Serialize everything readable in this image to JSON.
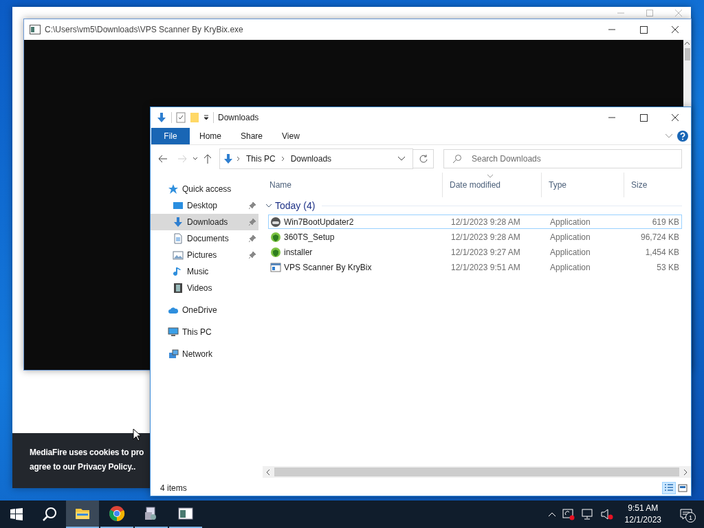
{
  "browser_window": {
    "cookie_banner": {
      "lines": [
        "MediaFire uses cookies to pro",
        "agree to our Privacy Policy.."
      ]
    }
  },
  "console_window": {
    "title": "C:\\Users\\vm5\\Downloads\\VPS Scanner By KryBix.exe"
  },
  "explorer": {
    "title": "Downloads",
    "ribbon_tabs": [
      {
        "label": "File",
        "kind": "menu"
      },
      {
        "label": "Home",
        "kind": "tab"
      },
      {
        "label": "Share",
        "kind": "tab"
      },
      {
        "label": "View",
        "kind": "tab"
      }
    ],
    "address": [
      "This PC",
      "Downloads"
    ],
    "search": {
      "placeholder": "Search Downloads"
    },
    "nav": [
      {
        "label": "Quick access",
        "selected": false,
        "children": [
          {
            "label": "Desktop",
            "selected": false,
            "pinned": true
          },
          {
            "label": "Downloads",
            "selected": true,
            "pinned": true
          },
          {
            "label": "Documents",
            "selected": false,
            "pinned": true
          },
          {
            "label": "Pictures",
            "selected": false,
            "pinned": true
          },
          {
            "label": "Music",
            "selected": false,
            "pinned": false
          },
          {
            "label": "Videos",
            "selected": false,
            "pinned": false
          }
        ]
      },
      {
        "label": "OneDrive",
        "selected": false
      },
      {
        "label": "This PC",
        "selected": false
      },
      {
        "label": "Network",
        "selected": false
      }
    ],
    "columns": [
      {
        "label": "Name",
        "sorted": false
      },
      {
        "label": "Date modified",
        "sorted": true
      },
      {
        "label": "Type",
        "sorted": false
      },
      {
        "label": "Size",
        "sorted": false
      }
    ],
    "groups": [
      {
        "label": "Today (4)",
        "expanded": true,
        "rows": [
          {
            "name": "Win7BootUpdater2",
            "date": "12/1/2023 9:28 AM",
            "type": "Application",
            "size": "619 KB",
            "selected": true
          },
          {
            "name": "360TS_Setup",
            "date": "12/1/2023 9:28 AM",
            "type": "Application",
            "size": "96,724 KB",
            "selected": false
          },
          {
            "name": "installer",
            "date": "12/1/2023 9:27 AM",
            "type": "Application",
            "size": "1,454 KB",
            "selected": false
          },
          {
            "name": "VPS Scanner By KryBix",
            "date": "12/1/2023 9:51 AM",
            "type": "Application",
            "size": "53 KB",
            "selected": false
          }
        ]
      }
    ],
    "status": "4 items"
  },
  "taskbar": {
    "apps": [
      {
        "active": true
      },
      {
        "active": false
      },
      {
        "active": false
      },
      {
        "active": false
      }
    ],
    "clock": {
      "time": "9:51 AM",
      "date": "12/1/2023"
    },
    "notifications": "1"
  }
}
